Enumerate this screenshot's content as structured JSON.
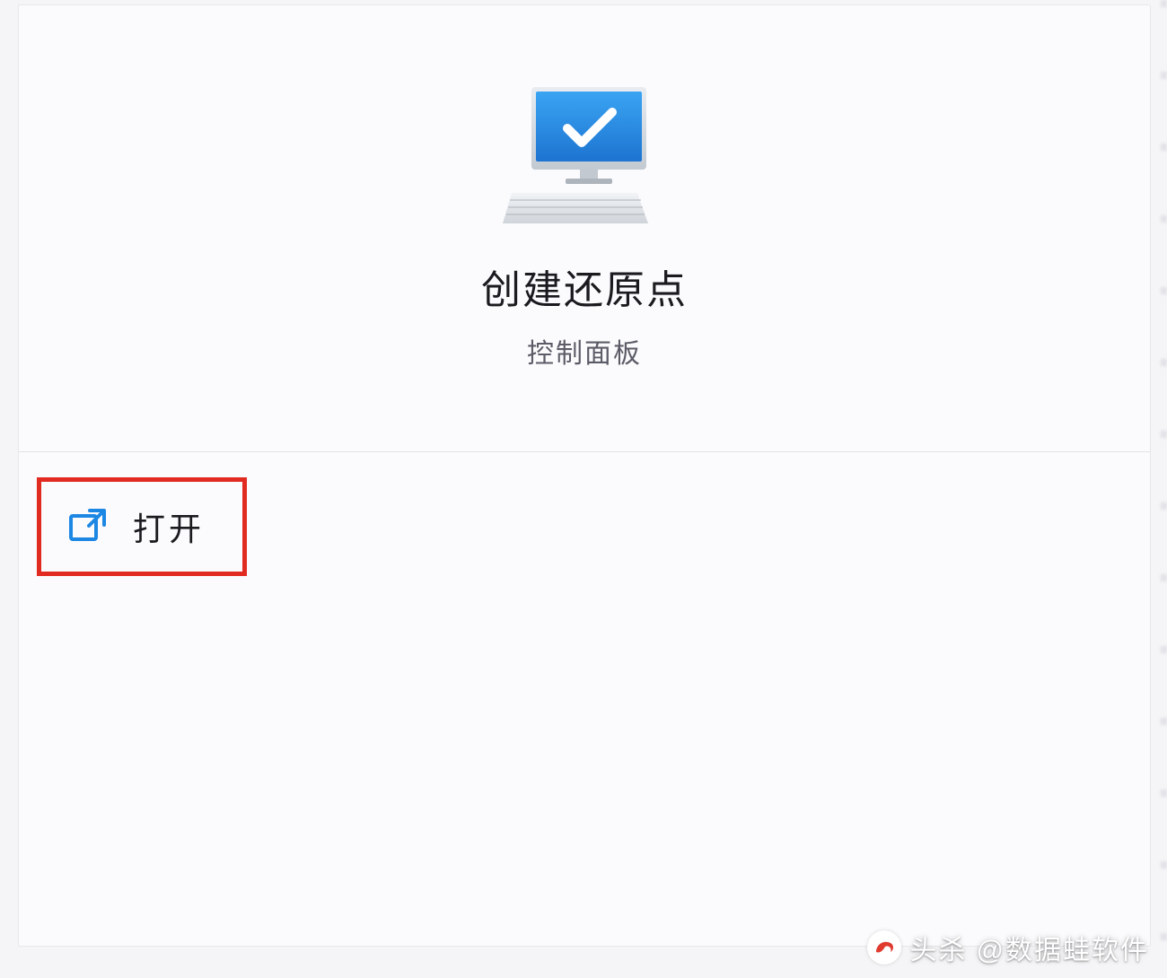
{
  "result": {
    "icon": "computer-check-icon",
    "title": "创建还原点",
    "subtitle": "控制面板"
  },
  "actions": {
    "open": {
      "icon": "open-external-icon",
      "label": "打开"
    }
  },
  "watermark": {
    "prefix": "头杀",
    "handle": "@数据蛙软件"
  },
  "colors": {
    "accent_blue": "#1d87e4",
    "highlight_red": "#e22b20"
  }
}
